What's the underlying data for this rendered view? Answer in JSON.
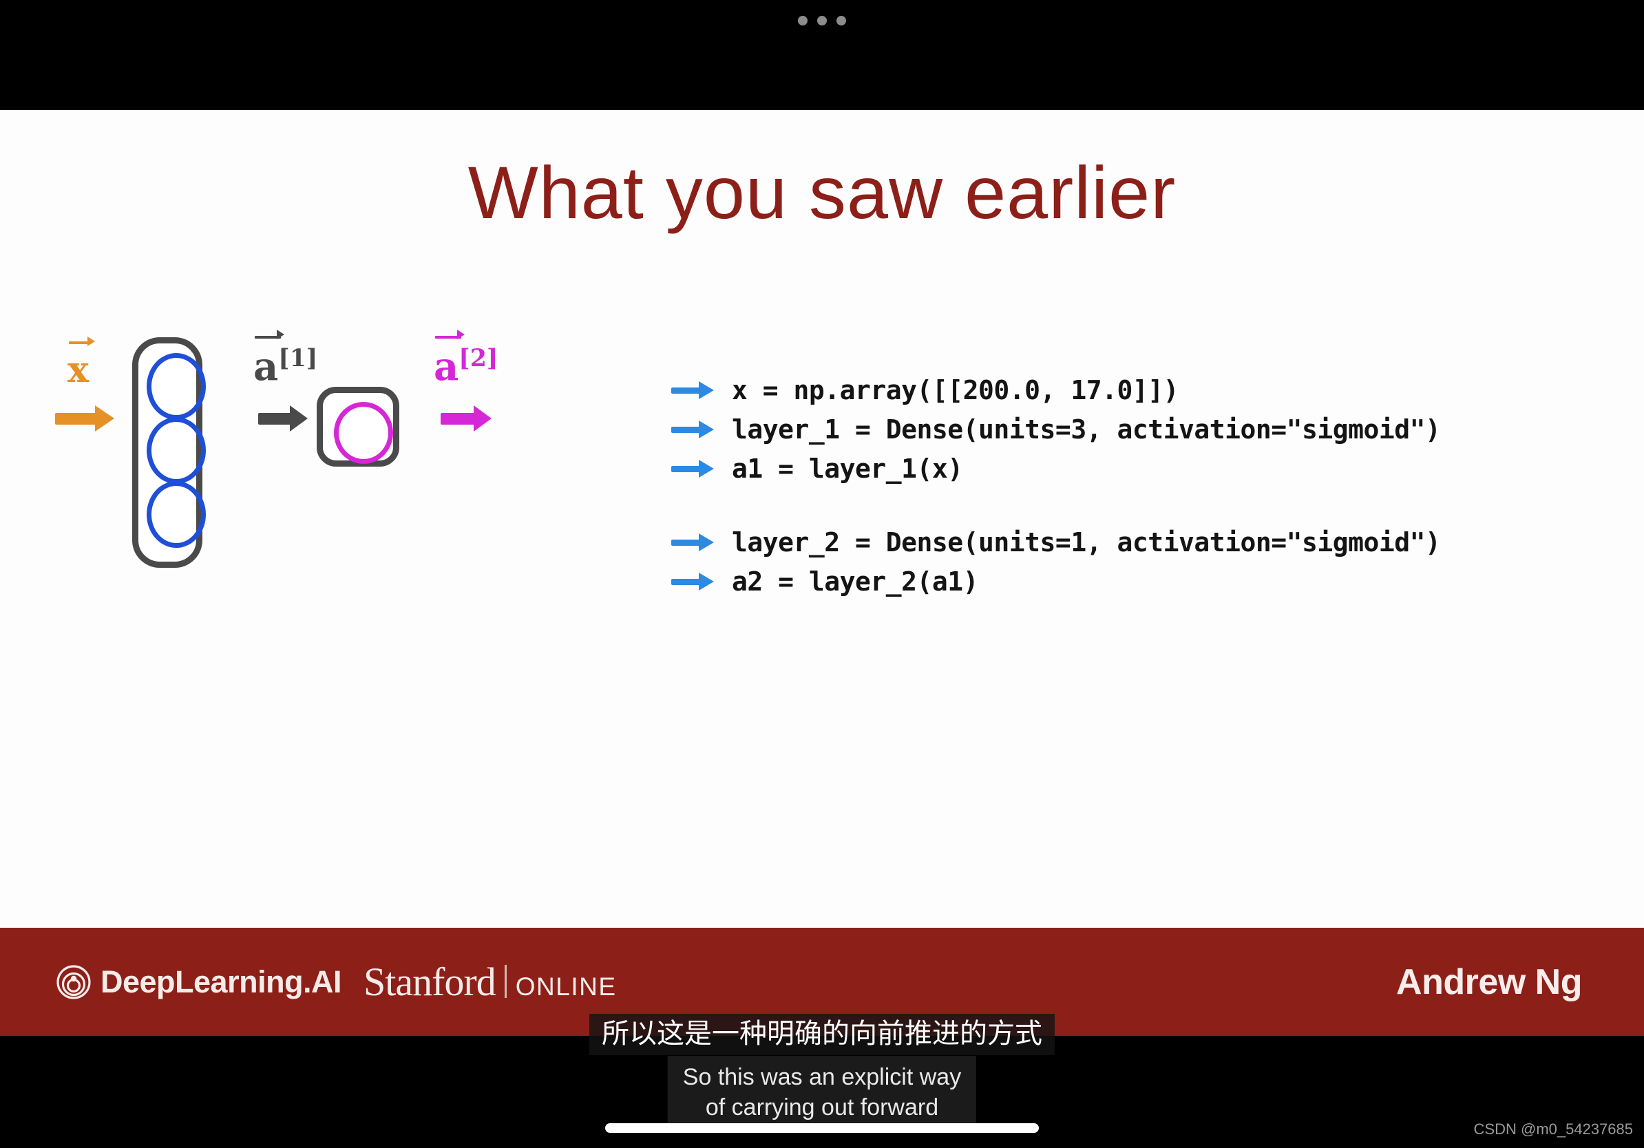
{
  "window": {
    "chrome_dots": 3
  },
  "slide": {
    "title": "What you saw earlier",
    "title_color": "#8c2019",
    "background": "#fdfdfd",
    "diagram": {
      "input_label_base": "x",
      "input_label_sup": "",
      "input_arrow_color": "#e69128",
      "hidden_layer": {
        "units": 3,
        "neuron_color": "#1f4fd8",
        "box_color": "#4a4a4a"
      },
      "layer1_output_label_base": "a",
      "layer1_output_label_sup": "[1]",
      "layer1_arrow_color": "#4a4a4a",
      "output_layer": {
        "units": 1,
        "neuron_color": "#d527d5",
        "box_color": "#4a4a4a"
      },
      "layer2_output_label_base": "a",
      "layer2_output_label_sup": "[2]",
      "layer2_arrow_color": "#d527d5"
    },
    "code": {
      "arrow_color": "#2a8ae4",
      "lines": [
        {
          "arrow": true,
          "text": "x = np.array([[200.0, 17.0]])"
        },
        {
          "arrow": true,
          "text": "layer_1 = Dense(units=3, activation=\"sigmoid\")"
        },
        {
          "arrow": true,
          "text": "a1 = layer_1(x)"
        },
        {
          "arrow": false,
          "text": ""
        },
        {
          "arrow": true,
          "text": "layer_2 = Dense(units=1, activation=\"sigmoid\")"
        },
        {
          "arrow": true,
          "text": "a2 = layer_2(a1)"
        }
      ]
    }
  },
  "footer": {
    "background": "#8c2019",
    "deeplearning_ai": "DeepLearning.AI",
    "stanford": "Stanford",
    "stanford_online": "ONLINE",
    "presenter": "Andrew Ng"
  },
  "subtitles": {
    "chinese": "所以这是一种明确的向前推进的方式",
    "english": "So this was an explicit way\nof carrying out forward"
  },
  "watermark": "CSDN @m0_54237685"
}
